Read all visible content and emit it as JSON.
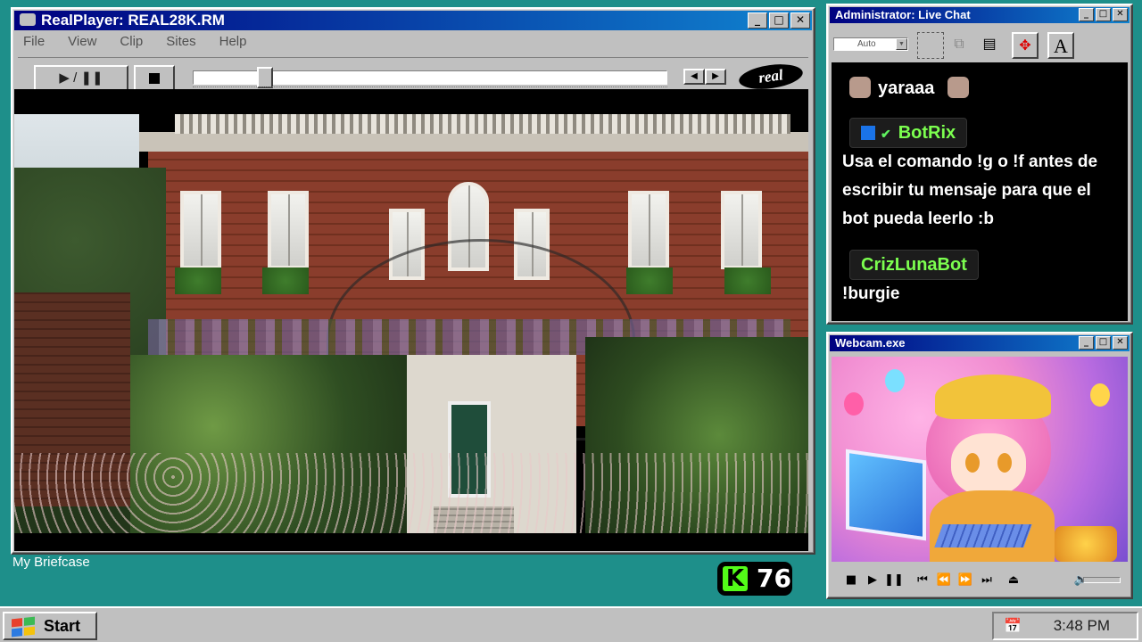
{
  "realplayer": {
    "title": "RealPlayer: REAL28K.RM",
    "menu": [
      "File",
      "View",
      "Clip",
      "Sites",
      "Help"
    ],
    "play_pause_label": "▶ / ❚❚",
    "logo_text": "real",
    "seek_progress": 0.14
  },
  "desktop": {
    "briefcase_label": "My Briefcase"
  },
  "kick": {
    "logo_letter": "K",
    "viewer_count": "76"
  },
  "chat": {
    "title": "Administrator: Live Chat",
    "font_size_select": "Auto",
    "messages": [
      {
        "user": "yaraaa"
      },
      {
        "user": "BotRix",
        "text": "Usa el comando !g o !f antes de escribir tu mensaje para que el bot pueda leerlo :b",
        "color": "#7cff4f"
      },
      {
        "user": "CrizLunaBot",
        "text": "!burgie",
        "color": "#7cff4f"
      }
    ]
  },
  "webcam": {
    "title": "Webcam.exe"
  },
  "taskbar": {
    "start_label": "Start",
    "clock": "3:48 PM"
  },
  "colors": {
    "desktop": "#1e8f8a",
    "titlebar": "#000080",
    "chat_username": "#7cff4f",
    "kick_green": "#53fc18"
  }
}
